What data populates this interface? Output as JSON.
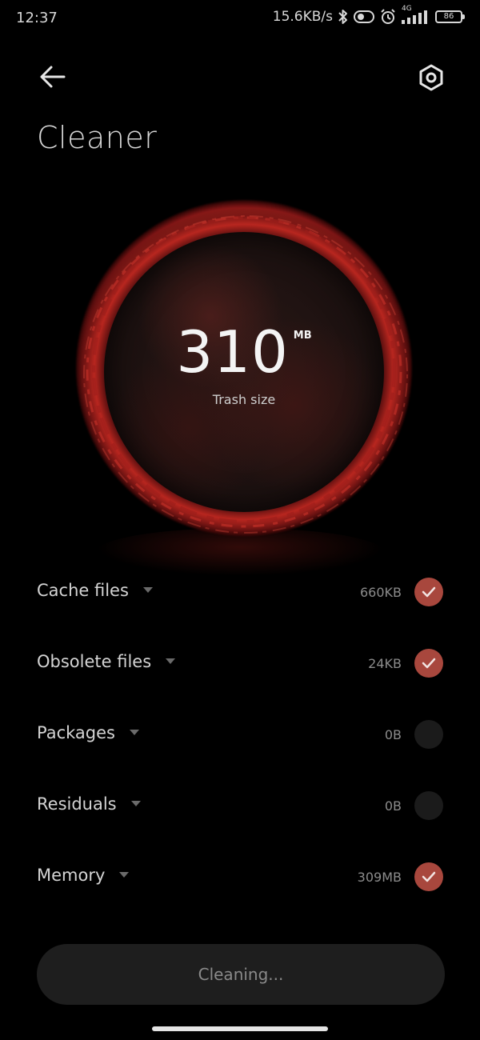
{
  "status_bar": {
    "time": "12:37",
    "network_speed": "15.6KB/s",
    "network_type": "4G",
    "battery": "86",
    "icons": [
      "bluetooth-icon",
      "toggle-icon",
      "alarm-icon",
      "signal-icon",
      "battery-icon"
    ]
  },
  "header": {
    "back_icon": "arrow-left-icon",
    "settings_icon": "hexagon-gear-icon",
    "title": "Cleaner"
  },
  "summary": {
    "value": "310",
    "unit": "MB",
    "caption": "Trash size",
    "accent_color": "#c02a22"
  },
  "items": [
    {
      "label": "Cache files",
      "size": "660KB",
      "checked": true
    },
    {
      "label": "Obsolete files",
      "size": "24KB",
      "checked": true
    },
    {
      "label": "Packages",
      "size": "0B",
      "checked": false
    },
    {
      "label": "Residuals",
      "size": "0B",
      "checked": false
    },
    {
      "label": "Memory",
      "size": "309MB",
      "checked": true
    }
  ],
  "action": {
    "label": "Cleaning..."
  },
  "colors": {
    "background": "#000000",
    "check_on": "#a8473d",
    "check_off": "#1b1b1b",
    "button_bg": "#1e1e1e"
  }
}
